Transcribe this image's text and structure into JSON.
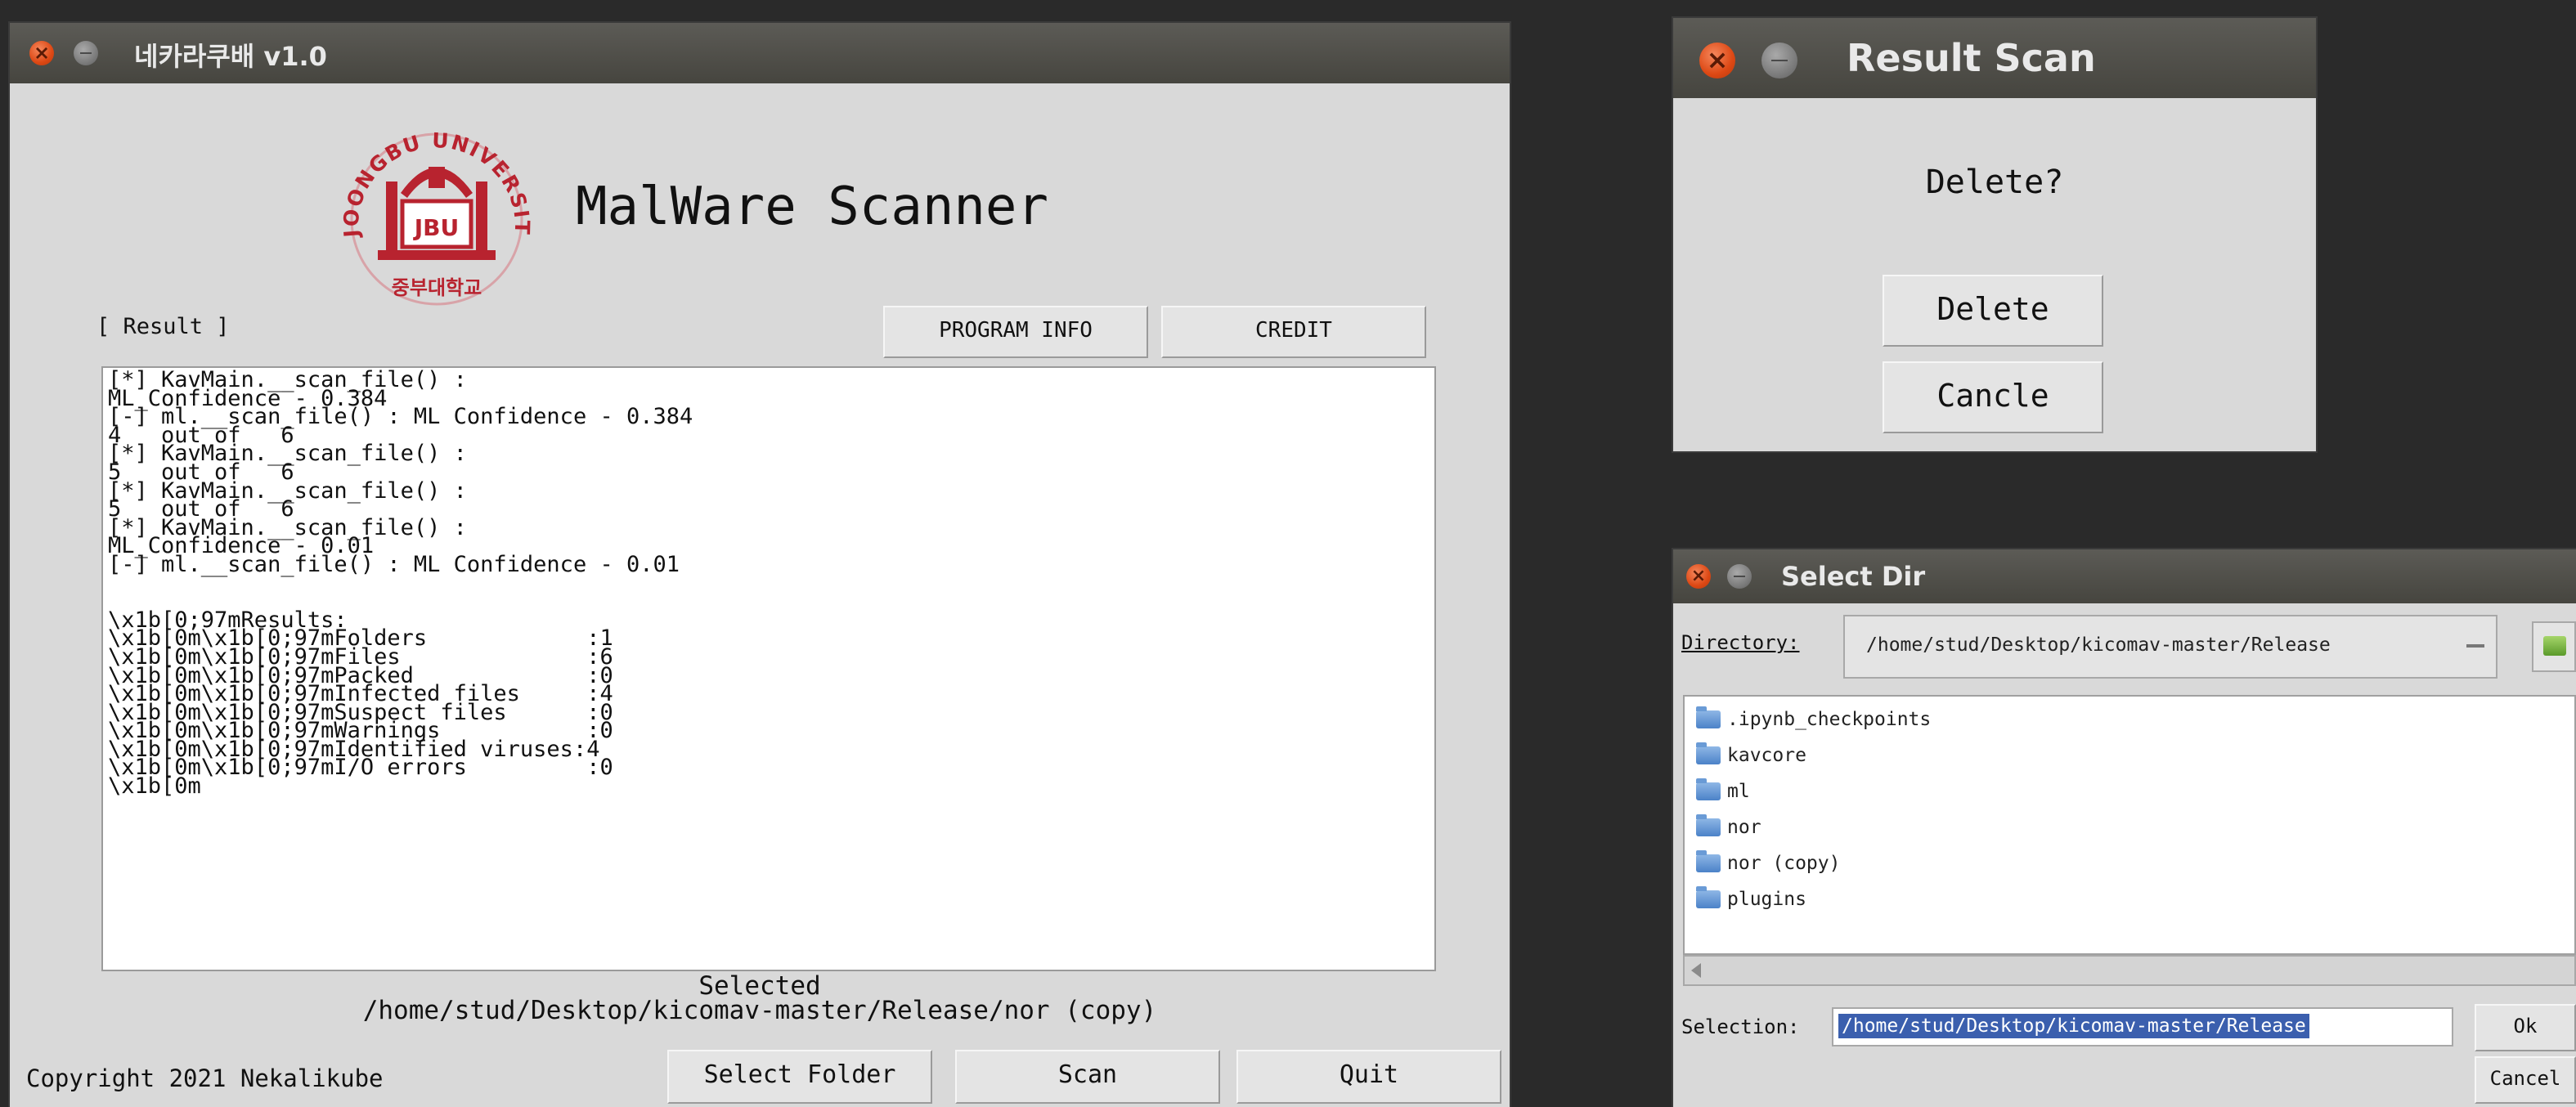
{
  "main_window": {
    "title": "네카라쿠배 v1.0",
    "app_title": "MalWare Scanner",
    "logo": {
      "ring_text": "JOONGBU UNIVERSITY",
      "center_text": "JBU",
      "bottom_text": "중부대학교"
    },
    "result_label": "[ Result ]",
    "program_info_button": "PROGRAM INFO",
    "credit_button": "CREDIT",
    "result_log": "[*] KavMain.__scan_file() :\nML_Confidence - 0.384\n[-] ml.__scan_file() : ML Confidence - 0.384\n4   out of   6\n[*] KavMain.__scan_file() :\n5   out of   6\n[*] KavMain.__scan_file() :\n5   out of   6\n[*] KavMain.__scan_file() :\nML_Confidence - 0.01\n[-] ml.__scan_file() : ML Confidence - 0.01\n\n\n\\x1b[0;97mResults:\n\\x1b[0m\\x1b[0;97mFolders            :1\n\\x1b[0m\\x1b[0;97mFiles              :6\n\\x1b[0m\\x1b[0;97mPacked             :0\n\\x1b[0m\\x1b[0;97mInfected files     :4\n\\x1b[0m\\x1b[0;97mSuspect files      :0\n\\x1b[0m\\x1b[0;97mWarnings           :0\n\\x1b[0m\\x1b[0;97mIdentified viruses:4\n\\x1b[0m\\x1b[0;97mI/O errors         :0\n\\x1b[0m",
    "selected_label": "Selected",
    "selected_path": "/home/stud/Desktop/kicomav-master/Release/nor (copy)",
    "copyright": "Copyright 2021 Nekalikube",
    "select_folder_button": "Select Folder",
    "scan_button": "Scan",
    "quit_button": "Quit"
  },
  "result_dialog": {
    "title": "Result Scan",
    "question": "Delete?",
    "delete_button": "Delete",
    "cancel_button": "Cancle"
  },
  "select_dir_dialog": {
    "title": "Select Dir",
    "directory_label": "Directory:",
    "directory_value": "/home/stud/Desktop/kicomav-master/Release",
    "folders": [
      ".ipynb_checkpoints",
      "kavcore",
      "ml",
      "nor",
      "nor (copy)",
      "plugins"
    ],
    "selection_label": "Selection:",
    "selection_value": "/home/stud/Desktop/kicomav-master/Release",
    "ok_button": "Ok",
    "cancel_button": "Cancel"
  },
  "colors": {
    "titlebar": "#4f4e49",
    "window_bg": "#d9d9d9",
    "close_button": "#dd4814",
    "logo_red": "#b8232f",
    "selection_highlight": "#3b5fae"
  }
}
